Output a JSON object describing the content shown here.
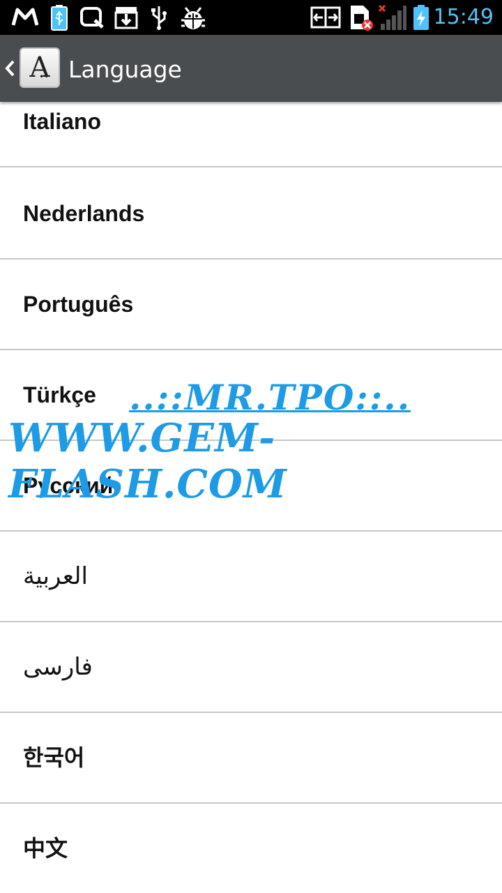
{
  "status_bar": {
    "time": "15:49",
    "icons": [
      "gmail-icon",
      "usb-battery-icon",
      "q-icon",
      "download-icon",
      "usb-icon",
      "android-debug-icon",
      "screen-share-icon",
      "sim-error-icon",
      "signal-icon",
      "battery-charging-icon"
    ],
    "time_color": "#4fc3f7"
  },
  "action_bar": {
    "title": "Language",
    "icon_letter": "A",
    "background": "#4a4d50"
  },
  "languages": [
    "Italiano",
    "Nederlands",
    "Português",
    "Türkçe",
    "Русский",
    "العربية",
    "فارسی",
    "한국어",
    "中文"
  ],
  "watermark": {
    "line1": "..::MR.TPO::..",
    "line2": "WWW.GEM-FLASH.COM",
    "color": "#1e9be6"
  }
}
